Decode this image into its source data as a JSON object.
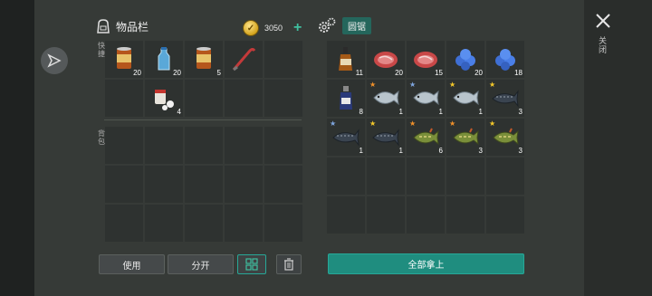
{
  "inventory": {
    "title": "物品栏",
    "coins": "3050",
    "add_coins_label": "+",
    "hotbar_label": "快捷",
    "backpack_label": "背包",
    "hotbar_items": [
      {
        "name": "canned-food",
        "count": "20"
      },
      {
        "name": "water-bottle",
        "count": "20"
      },
      {
        "name": "canned-food",
        "count": "5"
      },
      {
        "name": "crowbar",
        "count": ""
      },
      {
        "name": "empty",
        "count": ""
      },
      {
        "name": "empty",
        "count": ""
      },
      {
        "name": "pills",
        "count": "4"
      },
      {
        "name": "empty",
        "count": ""
      },
      {
        "name": "empty",
        "count": ""
      },
      {
        "name": "empty",
        "count": ""
      }
    ],
    "buttons": {
      "use": "使用",
      "split": "分开"
    }
  },
  "loot": {
    "title": "圆锯",
    "take_all": "全部拿上",
    "items": [
      {
        "name": "whiskey",
        "count": "11",
        "star": ""
      },
      {
        "name": "steak",
        "count": "20",
        "star": ""
      },
      {
        "name": "steak",
        "count": "15",
        "star": ""
      },
      {
        "name": "berries",
        "count": "20",
        "star": ""
      },
      {
        "name": "berries",
        "count": "18",
        "star": ""
      },
      {
        "name": "bottle",
        "count": "8",
        "star": ""
      },
      {
        "name": "salmon",
        "count": "1",
        "star": "orange"
      },
      {
        "name": "salmon",
        "count": "1",
        "star": "blue"
      },
      {
        "name": "salmon",
        "count": "1",
        "star": "yellow"
      },
      {
        "name": "sturgeon",
        "count": "3",
        "star": "yellow"
      },
      {
        "name": "sturgeon",
        "count": "1",
        "star": "blue"
      },
      {
        "name": "sturgeon",
        "count": "1",
        "star": "yellow"
      },
      {
        "name": "pike",
        "count": "6",
        "star": "orange"
      },
      {
        "name": "pike",
        "count": "3",
        "star": "orange"
      },
      {
        "name": "pike",
        "count": "3",
        "star": "yellow"
      }
    ]
  },
  "close_label": "关闭",
  "colors": {
    "accent": "#1f8d7f",
    "star_orange": "#f0902a",
    "star_blue": "#7fa6e0",
    "star_yellow": "#f5c92a"
  }
}
